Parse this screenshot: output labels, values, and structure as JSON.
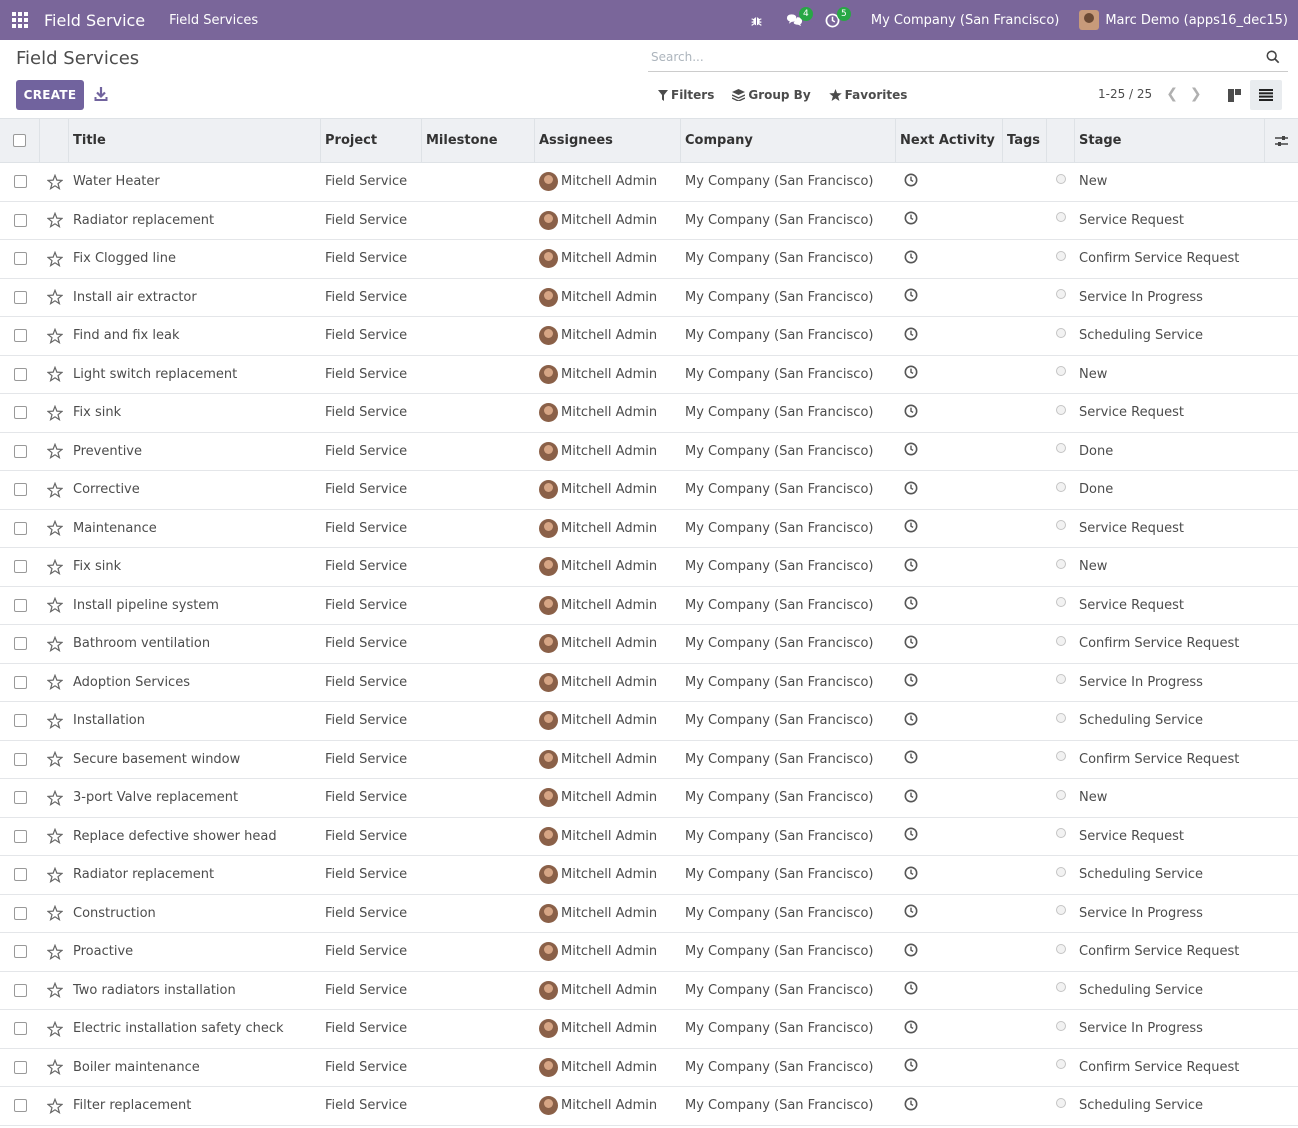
{
  "navbar": {
    "app_name": "Field Service",
    "menu_item": "Field Services",
    "messages_count": "4",
    "activities_count": "5",
    "company": "My Company (San Francisco)",
    "user": "Marc Demo (apps16_dec15)"
  },
  "control_panel": {
    "title": "Field Services",
    "search_placeholder": "Search...",
    "create_label": "CREATE",
    "filters_label": "Filters",
    "group_by_label": "Group By",
    "favorites_label": "Favorites",
    "pager": "1-25 / 25"
  },
  "columns": {
    "title": "Title",
    "project": "Project",
    "milestone": "Milestone",
    "assignees": "Assignees",
    "company": "Company",
    "next_activity": "Next Activity",
    "tags": "Tags",
    "stage": "Stage"
  },
  "rows": [
    {
      "title": "Water Heater",
      "project": "Field Service",
      "assignee": "Mitchell Admin",
      "company": "My Company (San Francisco)",
      "stage": "New"
    },
    {
      "title": "Radiator replacement",
      "project": "Field Service",
      "assignee": "Mitchell Admin",
      "company": "My Company (San Francisco)",
      "stage": "Service Request"
    },
    {
      "title": "Fix Clogged line",
      "project": "Field Service",
      "assignee": "Mitchell Admin",
      "company": "My Company (San Francisco)",
      "stage": "Confirm Service Request"
    },
    {
      "title": "Install air extractor",
      "project": "Field Service",
      "assignee": "Mitchell Admin",
      "company": "My Company (San Francisco)",
      "stage": "Service In Progress"
    },
    {
      "title": "Find and fix leak",
      "project": "Field Service",
      "assignee": "Mitchell Admin",
      "company": "My Company (San Francisco)",
      "stage": "Scheduling Service"
    },
    {
      "title": "Light switch replacement",
      "project": "Field Service",
      "assignee": "Mitchell Admin",
      "company": "My Company (San Francisco)",
      "stage": "New"
    },
    {
      "title": "Fix sink",
      "project": "Field Service",
      "assignee": "Mitchell Admin",
      "company": "My Company (San Francisco)",
      "stage": "Service Request"
    },
    {
      "title": "Preventive",
      "project": "Field Service",
      "assignee": "Mitchell Admin",
      "company": "My Company (San Francisco)",
      "stage": "Done"
    },
    {
      "title": "Corrective",
      "project": "Field Service",
      "assignee": "Mitchell Admin",
      "company": "My Company (San Francisco)",
      "stage": "Done"
    },
    {
      "title": "Maintenance",
      "project": "Field Service",
      "assignee": "Mitchell Admin",
      "company": "My Company (San Francisco)",
      "stage": "Service Request"
    },
    {
      "title": "Fix sink",
      "project": "Field Service",
      "assignee": "Mitchell Admin",
      "company": "My Company (San Francisco)",
      "stage": "New"
    },
    {
      "title": "Install pipeline system",
      "project": "Field Service",
      "assignee": "Mitchell Admin",
      "company": "My Company (San Francisco)",
      "stage": "Service Request"
    },
    {
      "title": "Bathroom ventilation",
      "project": "Field Service",
      "assignee": "Mitchell Admin",
      "company": "My Company (San Francisco)",
      "stage": "Confirm Service Request"
    },
    {
      "title": "Adoption Services",
      "project": "Field Service",
      "assignee": "Mitchell Admin",
      "company": "My Company (San Francisco)",
      "stage": "Service In Progress"
    },
    {
      "title": "Installation",
      "project": "Field Service",
      "assignee": "Mitchell Admin",
      "company": "My Company (San Francisco)",
      "stage": "Scheduling Service"
    },
    {
      "title": "Secure basement window",
      "project": "Field Service",
      "assignee": "Mitchell Admin",
      "company": "My Company (San Francisco)",
      "stage": "Confirm Service Request"
    },
    {
      "title": "3-port Valve replacement",
      "project": "Field Service",
      "assignee": "Mitchell Admin",
      "company": "My Company (San Francisco)",
      "stage": "New"
    },
    {
      "title": "Replace defective shower head",
      "project": "Field Service",
      "assignee": "Mitchell Admin",
      "company": "My Company (San Francisco)",
      "stage": "Service Request"
    },
    {
      "title": "Radiator replacement",
      "project": "Field Service",
      "assignee": "Mitchell Admin",
      "company": "My Company (San Francisco)",
      "stage": "Scheduling Service"
    },
    {
      "title": "Construction",
      "project": "Field Service",
      "assignee": "Mitchell Admin",
      "company": "My Company (San Francisco)",
      "stage": "Service In Progress"
    },
    {
      "title": "Proactive",
      "project": "Field Service",
      "assignee": "Mitchell Admin",
      "company": "My Company (San Francisco)",
      "stage": "Confirm Service Request"
    },
    {
      "title": "Two radiators installation",
      "project": "Field Service",
      "assignee": "Mitchell Admin",
      "company": "My Company (San Francisco)",
      "stage": "Scheduling Service"
    },
    {
      "title": "Electric installation safety check",
      "project": "Field Service",
      "assignee": "Mitchell Admin",
      "company": "My Company (San Francisco)",
      "stage": "Service In Progress"
    },
    {
      "title": "Boiler maintenance",
      "project": "Field Service",
      "assignee": "Mitchell Admin",
      "company": "My Company (San Francisco)",
      "stage": "Confirm Service Request"
    },
    {
      "title": "Filter replacement",
      "project": "Field Service",
      "assignee": "Mitchell Admin",
      "company": "My Company (San Francisco)",
      "stage": "Scheduling Service"
    }
  ]
}
